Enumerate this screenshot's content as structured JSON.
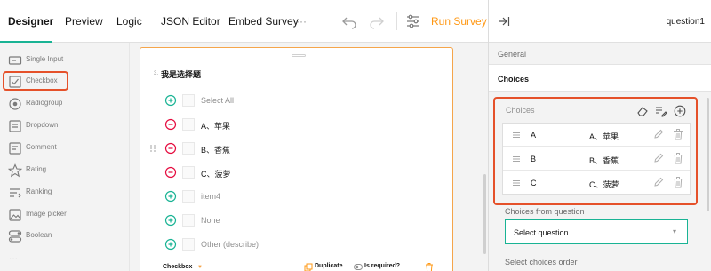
{
  "toolbar": {
    "tabs": [
      "Designer",
      "Preview",
      "Logic",
      "JSON Editor",
      "Embed Survey"
    ],
    "more": "···",
    "run_survey": "Run Survey"
  },
  "toolbox": {
    "items": [
      "Single Input",
      "Checkbox",
      "Radiogroup",
      "Dropdown",
      "Comment",
      "Rating",
      "Ranking",
      "Image picker",
      "Boolean"
    ],
    "more": "···"
  },
  "question": {
    "number": "3.",
    "title": "我是选择题",
    "choices": [
      {
        "label": "Select All",
        "state": "add",
        "muted": true
      },
      {
        "label": "A、苹果",
        "state": "remove",
        "muted": false
      },
      {
        "label": "B、香蕉",
        "state": "remove",
        "muted": false
      },
      {
        "label": "C、菠萝",
        "state": "remove",
        "muted": false
      },
      {
        "label": "item4",
        "state": "add",
        "muted": true
      },
      {
        "label": "None",
        "state": "add",
        "muted": true
      },
      {
        "label": "Other (describe)",
        "state": "add",
        "muted": true
      }
    ],
    "footer": {
      "type": "Checkbox",
      "duplicate": "Duplicate",
      "required": "Is required?"
    }
  },
  "panel": {
    "title": "question1",
    "categories": {
      "general": "General",
      "choices": "Choices"
    },
    "choices_editor": {
      "label": "Choices",
      "rows": [
        {
          "value": "A",
          "text": "A、苹果"
        },
        {
          "value": "B",
          "text": "B、香蕉"
        },
        {
          "value": "C",
          "text": "C、菠萝"
        }
      ]
    },
    "choices_from_question": {
      "label": "Choices from question",
      "value": "Select question..."
    },
    "select_choices_order": "Select choices order"
  },
  "colors": {
    "accent": "#19b394",
    "run": "#ff9814",
    "highlight": "#e5512a",
    "remove": "#e50a3e"
  }
}
